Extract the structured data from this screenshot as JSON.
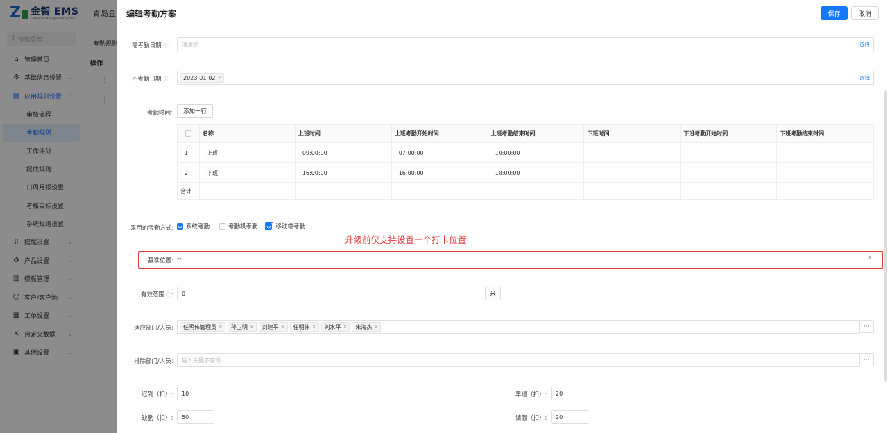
{
  "app": {
    "logo_text": "金智 EMS",
    "logo_sub": "Enterprise Management System",
    "company": "青岛金",
    "search_placeholder": "搜索菜单",
    "menu": [
      {
        "label": "管理首页",
        "icon": "home-icon"
      },
      {
        "label": "基础信息设置",
        "icon": "gear-icon"
      },
      {
        "label": "应用规则设置",
        "icon": "document-icon"
      }
    ],
    "submenu": [
      "审核流程",
      "考勤规则",
      "工作评分",
      "提成规则",
      "日周月报设置",
      "考核目标设置",
      "系统规则设置"
    ],
    "menu2": [
      {
        "label": "提醒设置",
        "icon": "bell-icon"
      },
      {
        "label": "产品设置",
        "icon": "gear-icon"
      },
      {
        "label": "模板管理",
        "icon": "template-icon"
      },
      {
        "label": "客户/客户池",
        "icon": "user-icon"
      },
      {
        "label": "工单设置",
        "icon": "ticket-icon"
      },
      {
        "label": "自定义数据",
        "icon": "tools-icon"
      },
      {
        "label": "其他设置",
        "icon": "grid-icon"
      }
    ],
    "bg_tab": "考勤规则",
    "bg_col": "操作"
  },
  "drawer": {
    "title": "编辑考勤方案",
    "save": "保存",
    "cancel": "取消",
    "need_date_label": "需考勤日期",
    "need_date_placeholder": "请添加",
    "select_link": "选择",
    "no_date_label": "不考勤日期",
    "no_date_tag": "2023-01-02",
    "time_label": "考勤时间:",
    "add_row": "添加一行",
    "table": {
      "headers": [
        "名称",
        "上班时间",
        "上班考勤开始时间",
        "上班考勤结束时间",
        "下班时间",
        "下班考勤开始时间",
        "下班考勤结束时间"
      ],
      "rows": [
        {
          "no": "1",
          "name": "上班",
          "c1": "09:00:00",
          "c2": "07:00:00",
          "c3": "10:00:00"
        },
        {
          "no": "2",
          "name": "下班",
          "c1": "16:00:00",
          "c2": "16:00:00",
          "c3": "18:00:00"
        }
      ],
      "sum": "合计"
    },
    "method_label": "采用的考勤方式:",
    "methods": [
      "系统考勤",
      "考勤机考勤",
      "移动端考勤"
    ],
    "annotation": "升级前仅支持设置一个打卡位置",
    "location_label": "基准位置:",
    "location_value": "--",
    "range_label": "有效范围",
    "range_value": "0",
    "range_unit": "米",
    "dept_label": "适应部门/人员:",
    "dept_tags": [
      "任明伟管理员",
      "孙卫明",
      "刘建平",
      "任明伟",
      "刘水平",
      "朱海杰"
    ],
    "dots": "···",
    "exclude_label": "排除部门/人员:",
    "exclude_placeholder": "输入关键字查询",
    "late_label": "迟到（扣）:",
    "late_value": "10",
    "early_label": "早退（扣）:",
    "early_value": "20",
    "absent_label": "缺勤（扣）:",
    "absent_value": "50",
    "leave_label": "请假（扣）:",
    "leave_value": "20"
  }
}
